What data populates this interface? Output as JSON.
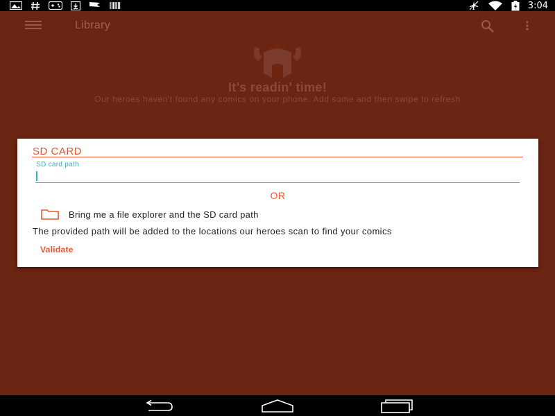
{
  "status_bar": {
    "time": "3:04",
    "left_icons": [
      "gallery-icon",
      "hashtag-icon",
      "gamepad-icon",
      "download-icon",
      "flag-icon",
      "barcode-icon"
    ],
    "right_icons": [
      "airplane-icon",
      "wifi-icon",
      "battery-icon"
    ]
  },
  "toolbar": {
    "title": "Library"
  },
  "empty_state": {
    "title": "It's readin' time!",
    "subtitle": "Our heroes haven't found any comics on your phone. Add some and then swipe to refresh"
  },
  "dialog": {
    "title": "SD CARD",
    "field_label": "SD card path",
    "field_value": "",
    "or_text": "OR",
    "explorer_label": "Bring me a file explorer and the SD card path",
    "info_text": "The provided path will be added to the locations our heroes scan to find your comics",
    "validate_label": "Validate"
  },
  "colors": {
    "background_dim": "#6c2413",
    "accent": "#e8552c",
    "field_accent": "#2ab3bd",
    "dialog_bg": "#ffffff"
  }
}
